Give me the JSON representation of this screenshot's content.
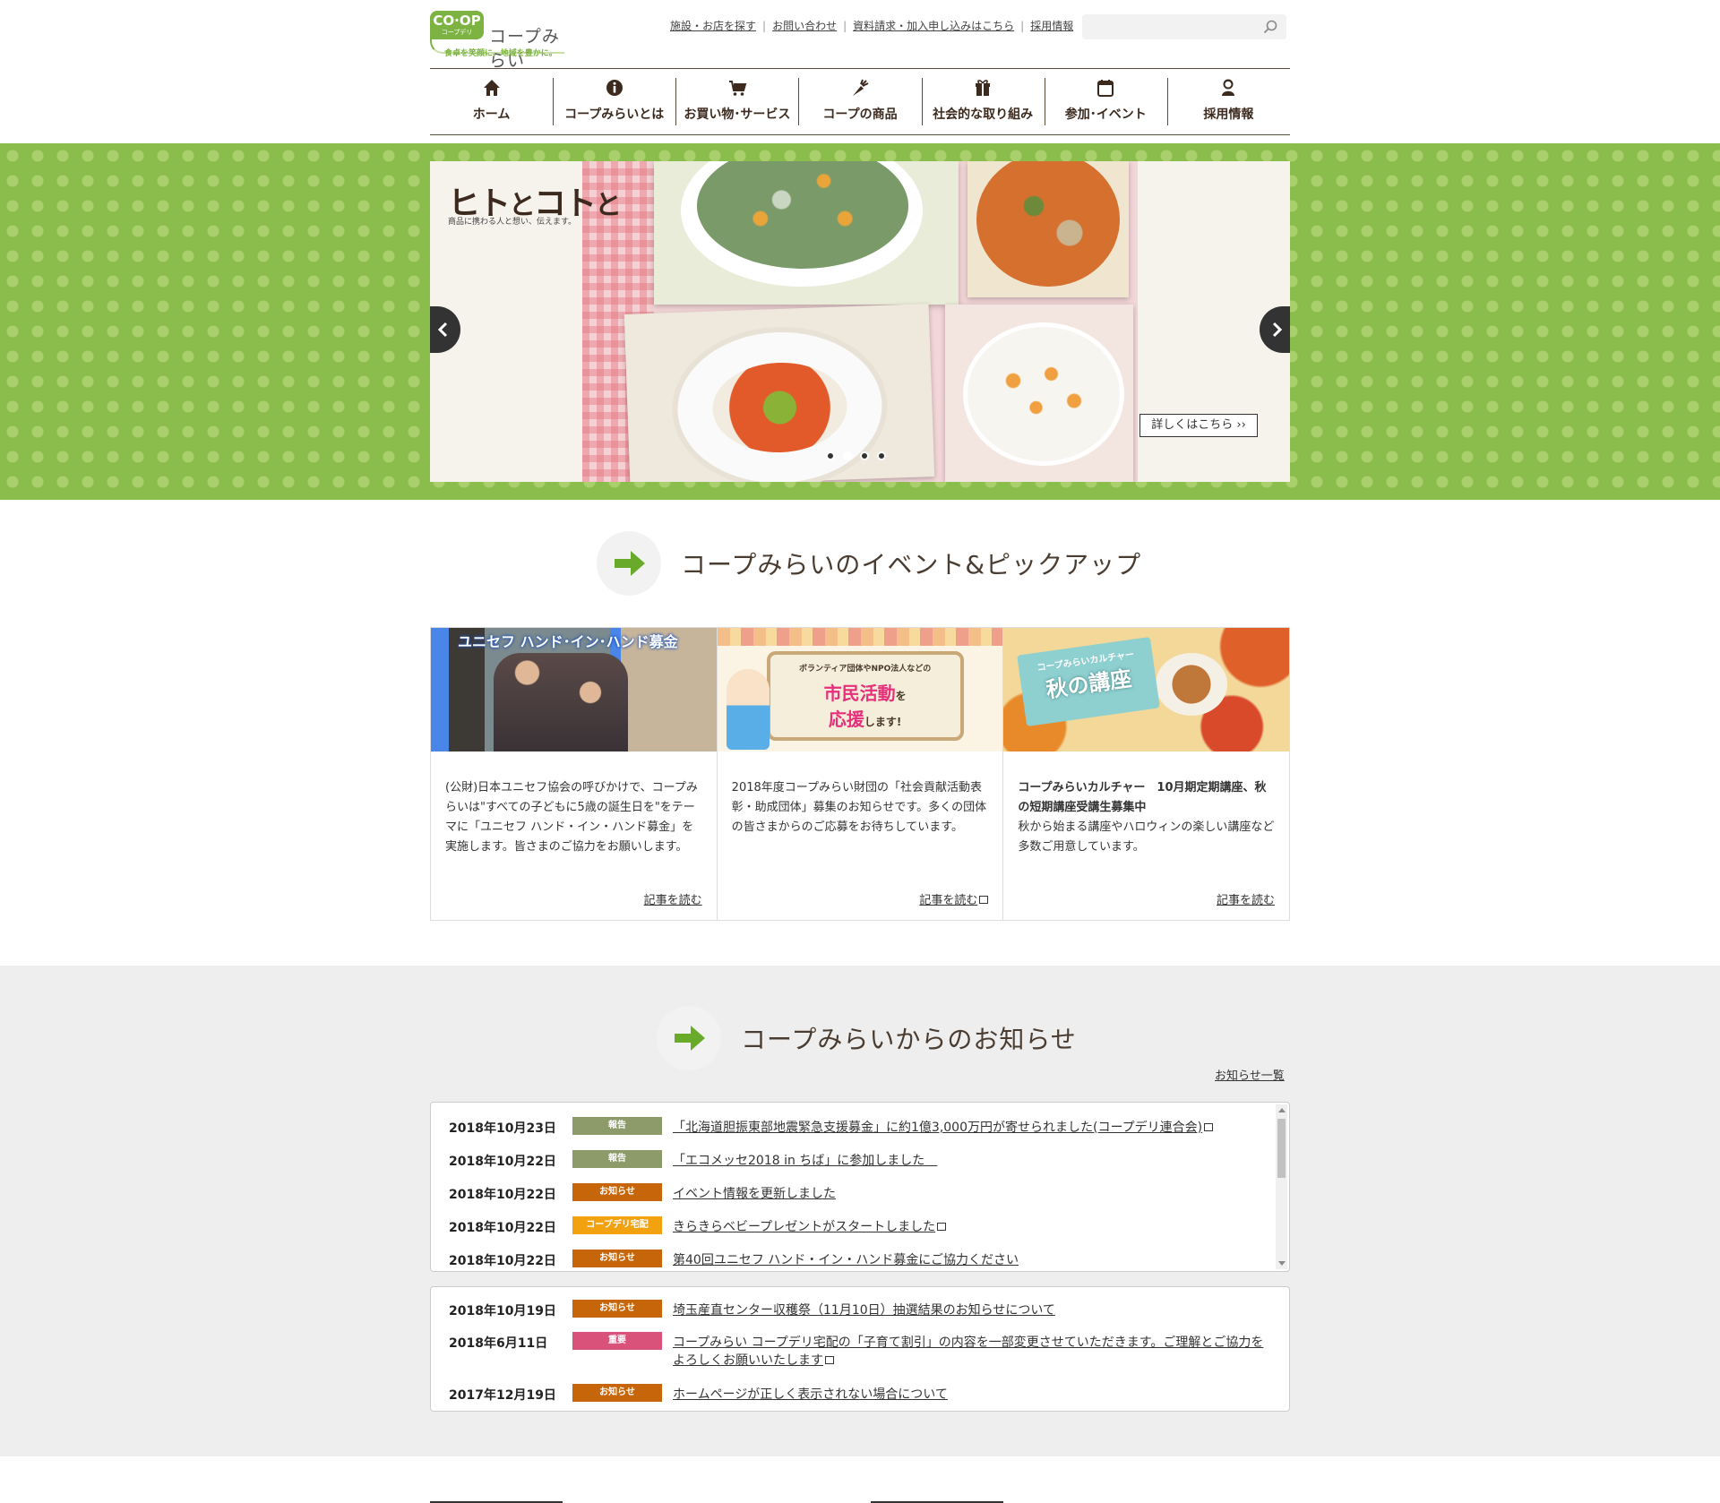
{
  "brand": {
    "badge": "CO·OP",
    "badge_sub": "コープデリ",
    "name": "コープみらい",
    "tagline": "食卓を笑顔に、地域を豊かに。",
    "accent": "#7cb342"
  },
  "utility_links": [
    "施設・お店を探す",
    "お問い合わせ",
    "資料請求・加入申し込みはこちら",
    "採用情報"
  ],
  "search": {
    "placeholder": "",
    "icon": "search-icon"
  },
  "global_nav": [
    {
      "label": "ホーム",
      "icon": "home-icon"
    },
    {
      "label": "コープみらいとは",
      "icon": "info-icon"
    },
    {
      "label": "お買い物･サービス",
      "icon": "cart-icon"
    },
    {
      "label": "コープの商品",
      "icon": "carrot-icon"
    },
    {
      "label": "社会的な取り組み",
      "icon": "gift-icon"
    },
    {
      "label": "参加･イベント",
      "icon": "calendar-icon"
    },
    {
      "label": "採用情報",
      "icon": "person-icon"
    }
  ],
  "hero": {
    "title_a": "ヒト",
    "title_and1": "と",
    "title_b": "コト",
    "title_and2": "と",
    "subtitle": "商品に携わる人と想い、伝えます。",
    "more_label": "詳しくはこちら ››",
    "slide_count": 4,
    "active_slide": 1
  },
  "pickup": {
    "heading": "コープみらいのイベント&ピックアップ",
    "cards": [
      {
        "image_caption": "ユニセフ ハンド･イン･ハンド募金",
        "bold": "",
        "text": "(公財)日本ユニセフ協会の呼びかけで、コープみらいは\"すべての子どもに5歳の誕生日を\"をテーマに「ユニセフ ハンド・イン・ハンド募金」を実施します。皆さまのご協力をお願いします。",
        "read_label": "記事を読む",
        "external": false
      },
      {
        "image_caption_small": "ボランティア団体やNPO法人などの",
        "image_caption_big1": "市民活動",
        "image_caption_mid": "を",
        "image_caption_big2": "応援",
        "image_caption_end": "します!",
        "bold": "",
        "text": "2018年度コープみらい財団の「社会貢献活動表彰・助成団体」募集のお知らせです。多くの団体の皆さまからのご応募をお待ちしています。",
        "read_label": "記事を読む",
        "external": true
      },
      {
        "image_caption_small": "コープみらいカルチャー",
        "image_caption_big": "秋の講座",
        "bold": "コープみらいカルチャー　10月期定期講座、秋の短期講座受講生募集中",
        "text": "秋から始まる講座やハロウィンの楽しい講座など多数ご用意しています。",
        "read_label": "記事を読む",
        "external": false
      }
    ]
  },
  "news": {
    "heading": "コープみらいからのお知らせ",
    "all_label": "お知らせ一覧",
    "list_a": [
      {
        "date": "2018年10月23日",
        "category": "報告",
        "color": "#8d9a6a",
        "title": "「北海道胆振東部地震緊急支援募金」に約1億3,000万円が寄せられました(コープデリ連合会)",
        "external": true
      },
      {
        "date": "2018年10月22日",
        "category": "報告",
        "color": "#8d9a6a",
        "title": "「エコメッセ2018 in ちば」に参加しました　",
        "external": false
      },
      {
        "date": "2018年10月22日",
        "category": "お知らせ",
        "color": "#c7650a",
        "title": "イベント情報を更新しました",
        "external": false
      },
      {
        "date": "2018年10月22日",
        "category": "コープデリ宅配",
        "color": "#f2a20f",
        "title": "きらきらベビープレゼントがスタートしました",
        "external": true
      },
      {
        "date": "2018年10月22日",
        "category": "お知らせ",
        "color": "#c7650a",
        "title": "第40回ユニセフ ハンド・イン・ハンド募金にご協力ください",
        "external": false
      }
    ],
    "list_b": [
      {
        "date": "2018年10月19日",
        "category": "お知らせ",
        "color": "#c7650a",
        "title": "埼玉産直センター収穫祭（11月10日）抽選結果のお知らせについて",
        "external": false
      },
      {
        "date": "2018年6月11日",
        "category": "重要",
        "color": "#d9527a",
        "title": "コープみらい コープデリ宅配の「子育て割引」の内容を一部変更させていただきます。ご理解とご協力をよろしくお願いいたします",
        "external": true
      },
      {
        "date": "2017年12月19日",
        "category": "お知らせ",
        "color": "#c7650a",
        "title": "ホームページが正しく表示されない場合について",
        "external": false
      }
    ]
  }
}
